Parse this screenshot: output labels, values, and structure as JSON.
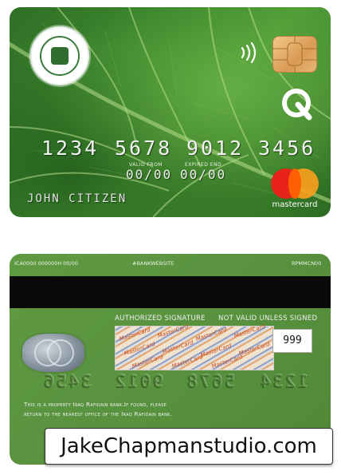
{
  "front": {
    "card_number": [
      "1234",
      "5678",
      "9012",
      "3456"
    ],
    "valid_from_label": "VALID FROM",
    "expired_end_label": "EXPIRED END",
    "valid_from": "00/00",
    "expired_end": "00/00",
    "cardholder": "JOHN CITIZEN",
    "network_label": "mastercard",
    "icons": [
      "bank-seal-icon",
      "contactless-icon",
      "chip-icon",
      "q-logo-icon",
      "mastercard-logo-icon"
    ],
    "colors": {
      "card_green": "#3f8a2e",
      "mc_red": "#e8231a",
      "mc_yellow": "#f79e1b"
    }
  },
  "back": {
    "top_left": "ICA0000 000000H 00/00",
    "top_center": "#BANKWEBSITE",
    "top_right": "RPMMCN00",
    "authorized_signature": "AUTHORIZED SIGNATURE",
    "not_valid": "NOT VALID UNLESS SIGNED",
    "cvv": "999",
    "embossed_groups": [
      "3456",
      "9012",
      "5678",
      "1234"
    ],
    "property_line1": "This is a property Iraq Rafidain bank.If found, please",
    "property_line2": "return to the nearest office of the Iraq Rafidain bank.",
    "panel_text": "MasterCard",
    "icons": [
      "hologram-icon"
    ]
  },
  "watermark": "JakeChapmanstudio.com"
}
